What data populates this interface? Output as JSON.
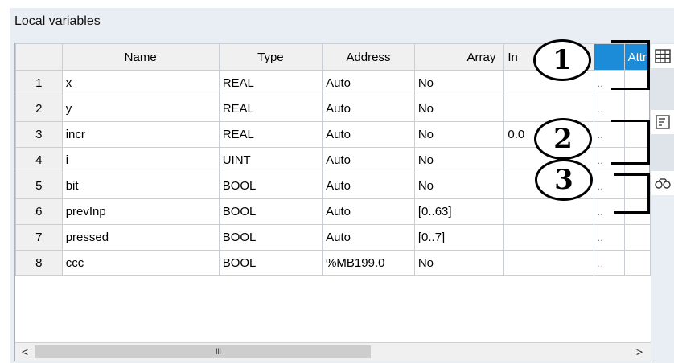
{
  "panel": {
    "title": "Local variables"
  },
  "table": {
    "columns": [
      "Name",
      "Type",
      "Address",
      "Array",
      "In",
      "",
      "Attr"
    ],
    "rows": [
      {
        "num": "1",
        "name": "x",
        "type": "REAL",
        "address": "Auto",
        "array": "No",
        "init": "",
        "dots": ".."
      },
      {
        "num": "2",
        "name": "y",
        "type": "REAL",
        "address": "Auto",
        "array": "No",
        "init": "",
        "dots": ".."
      },
      {
        "num": "3",
        "name": "incr",
        "type": "REAL",
        "address": "Auto",
        "array": "No",
        "init": "0.0",
        "dots": ".."
      },
      {
        "num": "4",
        "name": "i",
        "type": "UINT",
        "address": "Auto",
        "array": "No",
        "init": "",
        "dots": ".."
      },
      {
        "num": "5",
        "name": "bit",
        "type": "BOOL",
        "address": "Auto",
        "array": "No",
        "init": "",
        "dots": ".."
      },
      {
        "num": "6",
        "name": "prevInp",
        "type": "BOOL",
        "address": "Auto",
        "array": "[0..63]",
        "init": "",
        "dots": ".."
      },
      {
        "num": "7",
        "name": "pressed",
        "type": "BOOL",
        "address": "Auto",
        "array": "[0..7]",
        "init": "",
        "dots": ".."
      },
      {
        "num": "8",
        "name": "ccc",
        "type": "BOOL",
        "address": "%MB199.0",
        "array": "No",
        "init": "",
        "dots": ".."
      }
    ]
  },
  "scrollbar": {
    "left_arrow": "<",
    "right_arrow": ">",
    "grip": "III"
  },
  "sidebar": {
    "buttons": [
      "table-grid-icon",
      "properties-icon",
      "link-icon"
    ]
  },
  "callouts": [
    "1",
    "2",
    "3"
  ],
  "colors": {
    "panel_bg": "#e9edf4",
    "header_bg": "#f0f0f0",
    "selected_header": "#1c8cd8"
  }
}
